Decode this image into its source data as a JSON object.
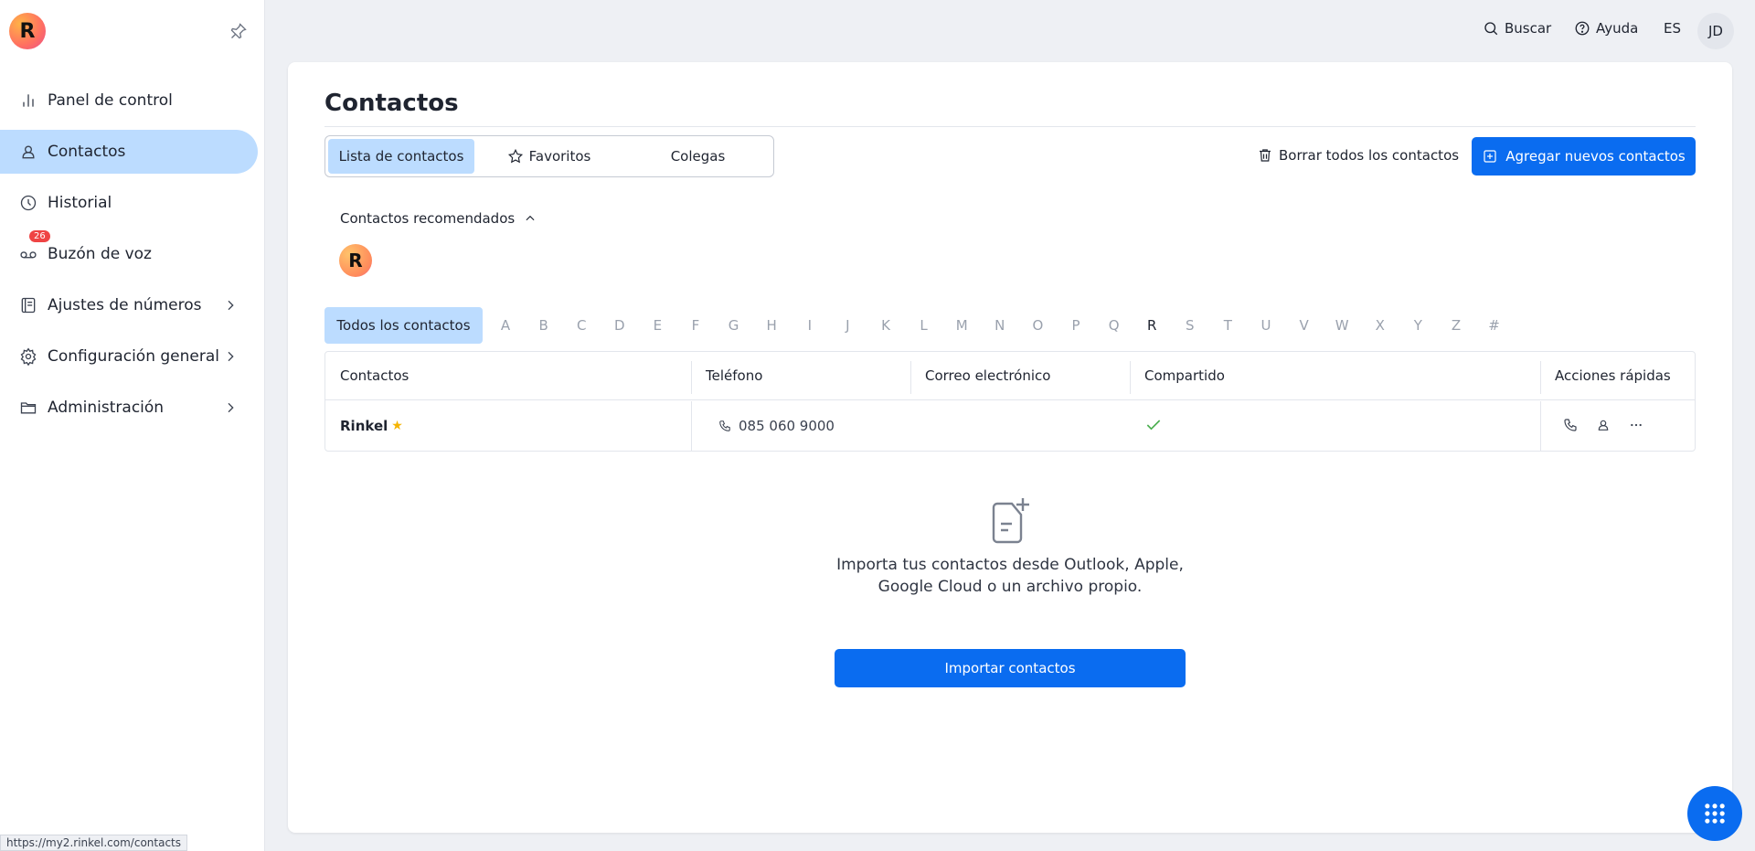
{
  "sidebar": {
    "logo_letter": "R",
    "items": [
      {
        "label": "Panel de control"
      },
      {
        "label": "Contactos"
      },
      {
        "label": "Historial"
      },
      {
        "label": "Buzón de voz",
        "badge": "26"
      },
      {
        "label": "Ajustes de números"
      },
      {
        "label": "Configuración general"
      },
      {
        "label": "Administración"
      }
    ]
  },
  "header": {
    "search_label": "Buscar",
    "help_label": "Ayuda",
    "lang": "ES",
    "user_initials": "JD"
  },
  "page": {
    "title": "Contactos",
    "tabs": [
      {
        "label": "Lista de contactos"
      },
      {
        "label": "Favoritos"
      },
      {
        "label": "Colegas"
      }
    ],
    "delete_all_label": "Borrar todos los contactos",
    "add_label": "Agregar nuevos contactos",
    "recommended_label": "Contactos recomendados",
    "recommended_avatar": "R",
    "all_contacts_label": "Todos los contactos",
    "letters": [
      "A",
      "B",
      "C",
      "D",
      "E",
      "F",
      "G",
      "H",
      "I",
      "J",
      "K",
      "L",
      "M",
      "N",
      "O",
      "P",
      "Q",
      "R",
      "S",
      "T",
      "U",
      "V",
      "W",
      "X",
      "Y",
      "Z",
      "#"
    ],
    "active_letter": "R",
    "table": {
      "headers": [
        "Contactos",
        "Teléfono",
        "Correo electrónico",
        "Compartido",
        "Acciones rápidas"
      ],
      "rows": [
        {
          "name": "Rinkel",
          "favorite": true,
          "phone": "085 060 9000",
          "email": "",
          "shared": true
        }
      ]
    },
    "empty_text_line1": "Importa tus contactos desde Outlook, Apple,",
    "empty_text_line2": "Google Cloud o un archivo propio.",
    "import_label": "Importar contactos"
  },
  "statusbar_url": "https://my2.rinkel.com/contacts",
  "colors": {
    "accent": "#0a6cf0",
    "active_bg": "#bcdcff",
    "badge": "#ef4444",
    "check": "#4caf50",
    "star": "#f5b400"
  }
}
